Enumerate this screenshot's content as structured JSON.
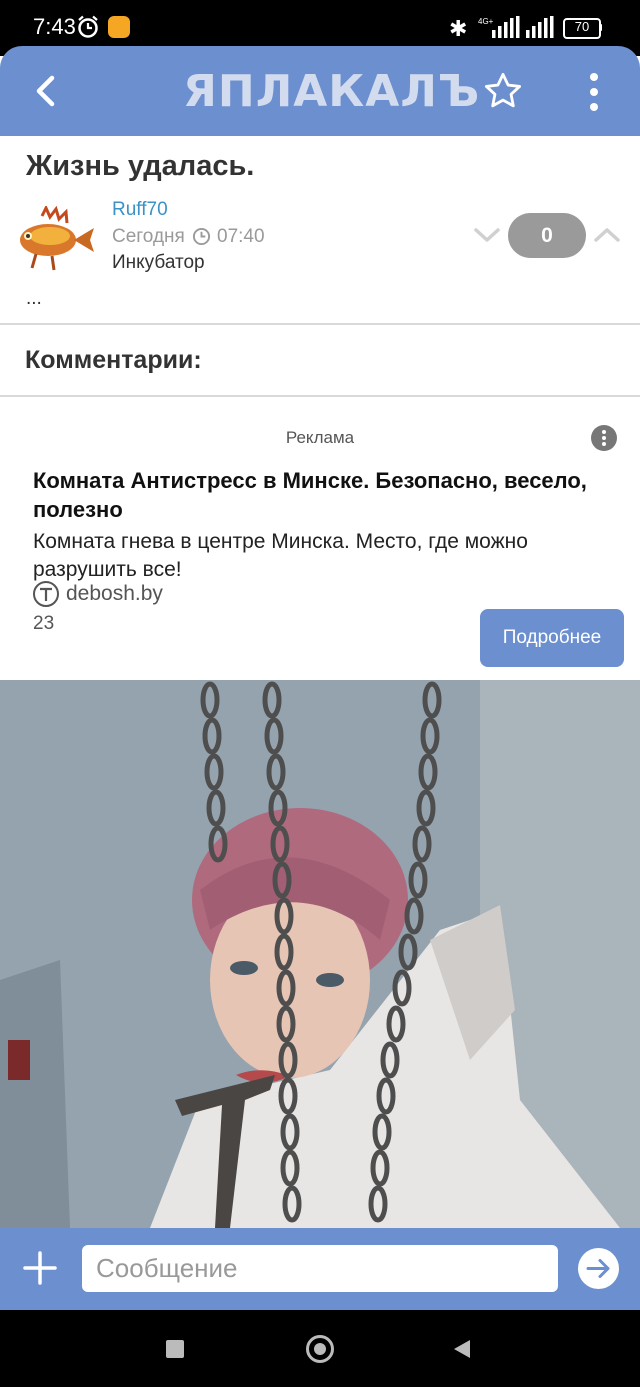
{
  "status_bar": {
    "time": "7:43",
    "battery": "70",
    "network": "4G+"
  },
  "header": {
    "logo": "ЯПЛАКАЛЪ"
  },
  "post": {
    "title": "Жизнь удалась.",
    "author": "Ruff70",
    "date": "Сегодня",
    "time": "07:40",
    "section": "Инкубатор",
    "rating": "0",
    "ellipsis": "..."
  },
  "comments": {
    "heading": "Комментарии:"
  },
  "ad": {
    "label": "Реклама",
    "title": "Комната Антистресс в Минске. Безопасно, весело, полезно",
    "text": "Комната гнева в центре Минска. Место, где можно разрушить все!",
    "domain": "debosh.by",
    "age": "23",
    "button": "Подробнее"
  },
  "input_bar": {
    "placeholder": "Сообщение"
  },
  "colors": {
    "accent": "#6b8fcf",
    "author_link": "#3a92c6",
    "rating_bg": "#9a9a9a"
  }
}
